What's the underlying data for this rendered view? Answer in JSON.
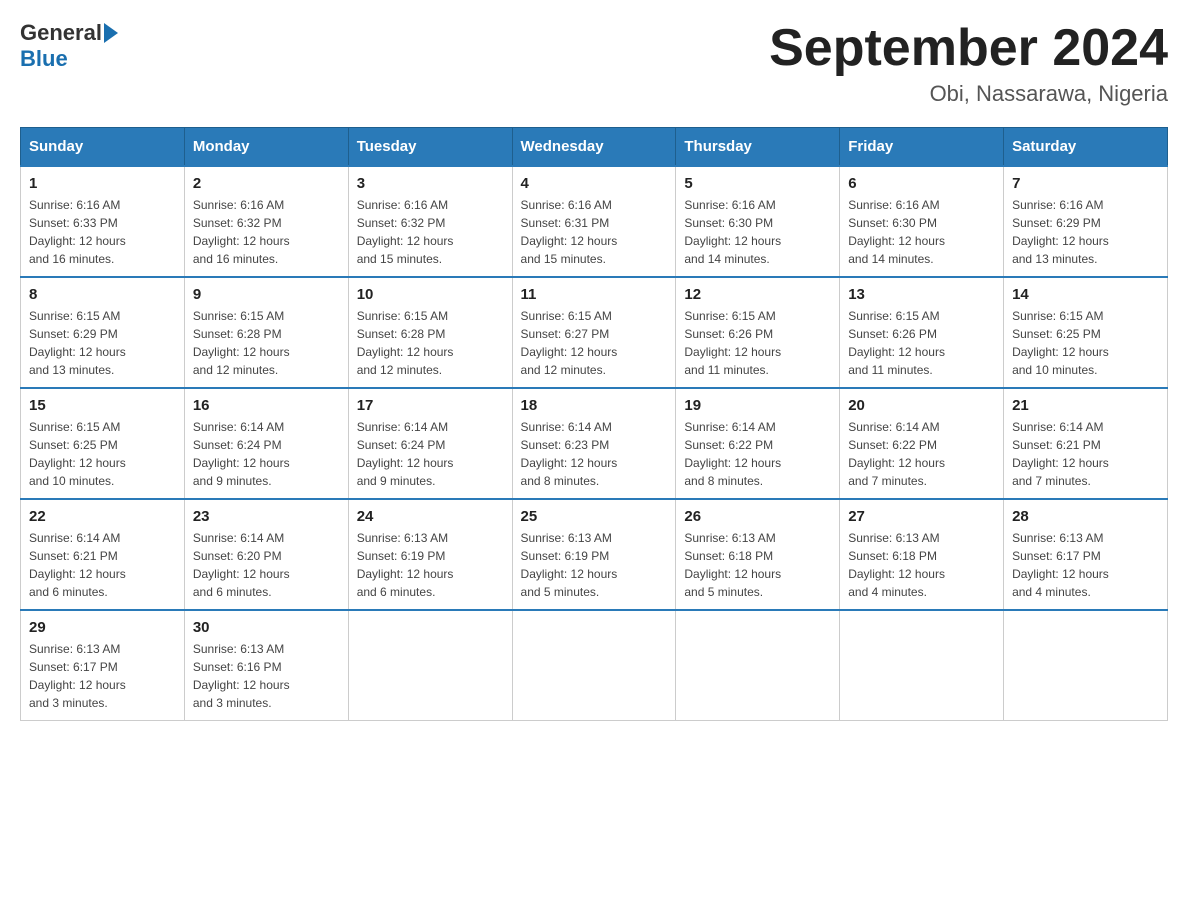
{
  "header": {
    "logo_general": "General",
    "logo_blue": "Blue",
    "title": "September 2024",
    "subtitle": "Obi, Nassarawa, Nigeria"
  },
  "days_of_week": [
    "Sunday",
    "Monday",
    "Tuesday",
    "Wednesday",
    "Thursday",
    "Friday",
    "Saturday"
  ],
  "weeks": [
    [
      {
        "day": "1",
        "sunrise": "6:16 AM",
        "sunset": "6:33 PM",
        "daylight": "12 hours and 16 minutes."
      },
      {
        "day": "2",
        "sunrise": "6:16 AM",
        "sunset": "6:32 PM",
        "daylight": "12 hours and 16 minutes."
      },
      {
        "day": "3",
        "sunrise": "6:16 AM",
        "sunset": "6:32 PM",
        "daylight": "12 hours and 15 minutes."
      },
      {
        "day": "4",
        "sunrise": "6:16 AM",
        "sunset": "6:31 PM",
        "daylight": "12 hours and 15 minutes."
      },
      {
        "day": "5",
        "sunrise": "6:16 AM",
        "sunset": "6:30 PM",
        "daylight": "12 hours and 14 minutes."
      },
      {
        "day": "6",
        "sunrise": "6:16 AM",
        "sunset": "6:30 PM",
        "daylight": "12 hours and 14 minutes."
      },
      {
        "day": "7",
        "sunrise": "6:16 AM",
        "sunset": "6:29 PM",
        "daylight": "12 hours and 13 minutes."
      }
    ],
    [
      {
        "day": "8",
        "sunrise": "6:15 AM",
        "sunset": "6:29 PM",
        "daylight": "12 hours and 13 minutes."
      },
      {
        "day": "9",
        "sunrise": "6:15 AM",
        "sunset": "6:28 PM",
        "daylight": "12 hours and 12 minutes."
      },
      {
        "day": "10",
        "sunrise": "6:15 AM",
        "sunset": "6:28 PM",
        "daylight": "12 hours and 12 minutes."
      },
      {
        "day": "11",
        "sunrise": "6:15 AM",
        "sunset": "6:27 PM",
        "daylight": "12 hours and 12 minutes."
      },
      {
        "day": "12",
        "sunrise": "6:15 AM",
        "sunset": "6:26 PM",
        "daylight": "12 hours and 11 minutes."
      },
      {
        "day": "13",
        "sunrise": "6:15 AM",
        "sunset": "6:26 PM",
        "daylight": "12 hours and 11 minutes."
      },
      {
        "day": "14",
        "sunrise": "6:15 AM",
        "sunset": "6:25 PM",
        "daylight": "12 hours and 10 minutes."
      }
    ],
    [
      {
        "day": "15",
        "sunrise": "6:15 AM",
        "sunset": "6:25 PM",
        "daylight": "12 hours and 10 minutes."
      },
      {
        "day": "16",
        "sunrise": "6:14 AM",
        "sunset": "6:24 PM",
        "daylight": "12 hours and 9 minutes."
      },
      {
        "day": "17",
        "sunrise": "6:14 AM",
        "sunset": "6:24 PM",
        "daylight": "12 hours and 9 minutes."
      },
      {
        "day": "18",
        "sunrise": "6:14 AM",
        "sunset": "6:23 PM",
        "daylight": "12 hours and 8 minutes."
      },
      {
        "day": "19",
        "sunrise": "6:14 AM",
        "sunset": "6:22 PM",
        "daylight": "12 hours and 8 minutes."
      },
      {
        "day": "20",
        "sunrise": "6:14 AM",
        "sunset": "6:22 PM",
        "daylight": "12 hours and 7 minutes."
      },
      {
        "day": "21",
        "sunrise": "6:14 AM",
        "sunset": "6:21 PM",
        "daylight": "12 hours and 7 minutes."
      }
    ],
    [
      {
        "day": "22",
        "sunrise": "6:14 AM",
        "sunset": "6:21 PM",
        "daylight": "12 hours and 6 minutes."
      },
      {
        "day": "23",
        "sunrise": "6:14 AM",
        "sunset": "6:20 PM",
        "daylight": "12 hours and 6 minutes."
      },
      {
        "day": "24",
        "sunrise": "6:13 AM",
        "sunset": "6:19 PM",
        "daylight": "12 hours and 6 minutes."
      },
      {
        "day": "25",
        "sunrise": "6:13 AM",
        "sunset": "6:19 PM",
        "daylight": "12 hours and 5 minutes."
      },
      {
        "day": "26",
        "sunrise": "6:13 AM",
        "sunset": "6:18 PM",
        "daylight": "12 hours and 5 minutes."
      },
      {
        "day": "27",
        "sunrise": "6:13 AM",
        "sunset": "6:18 PM",
        "daylight": "12 hours and 4 minutes."
      },
      {
        "day": "28",
        "sunrise": "6:13 AM",
        "sunset": "6:17 PM",
        "daylight": "12 hours and 4 minutes."
      }
    ],
    [
      {
        "day": "29",
        "sunrise": "6:13 AM",
        "sunset": "6:17 PM",
        "daylight": "12 hours and 3 minutes."
      },
      {
        "day": "30",
        "sunrise": "6:13 AM",
        "sunset": "6:16 PM",
        "daylight": "12 hours and 3 minutes."
      },
      null,
      null,
      null,
      null,
      null
    ]
  ],
  "labels": {
    "sunrise": "Sunrise:",
    "sunset": "Sunset:",
    "daylight": "Daylight:"
  }
}
